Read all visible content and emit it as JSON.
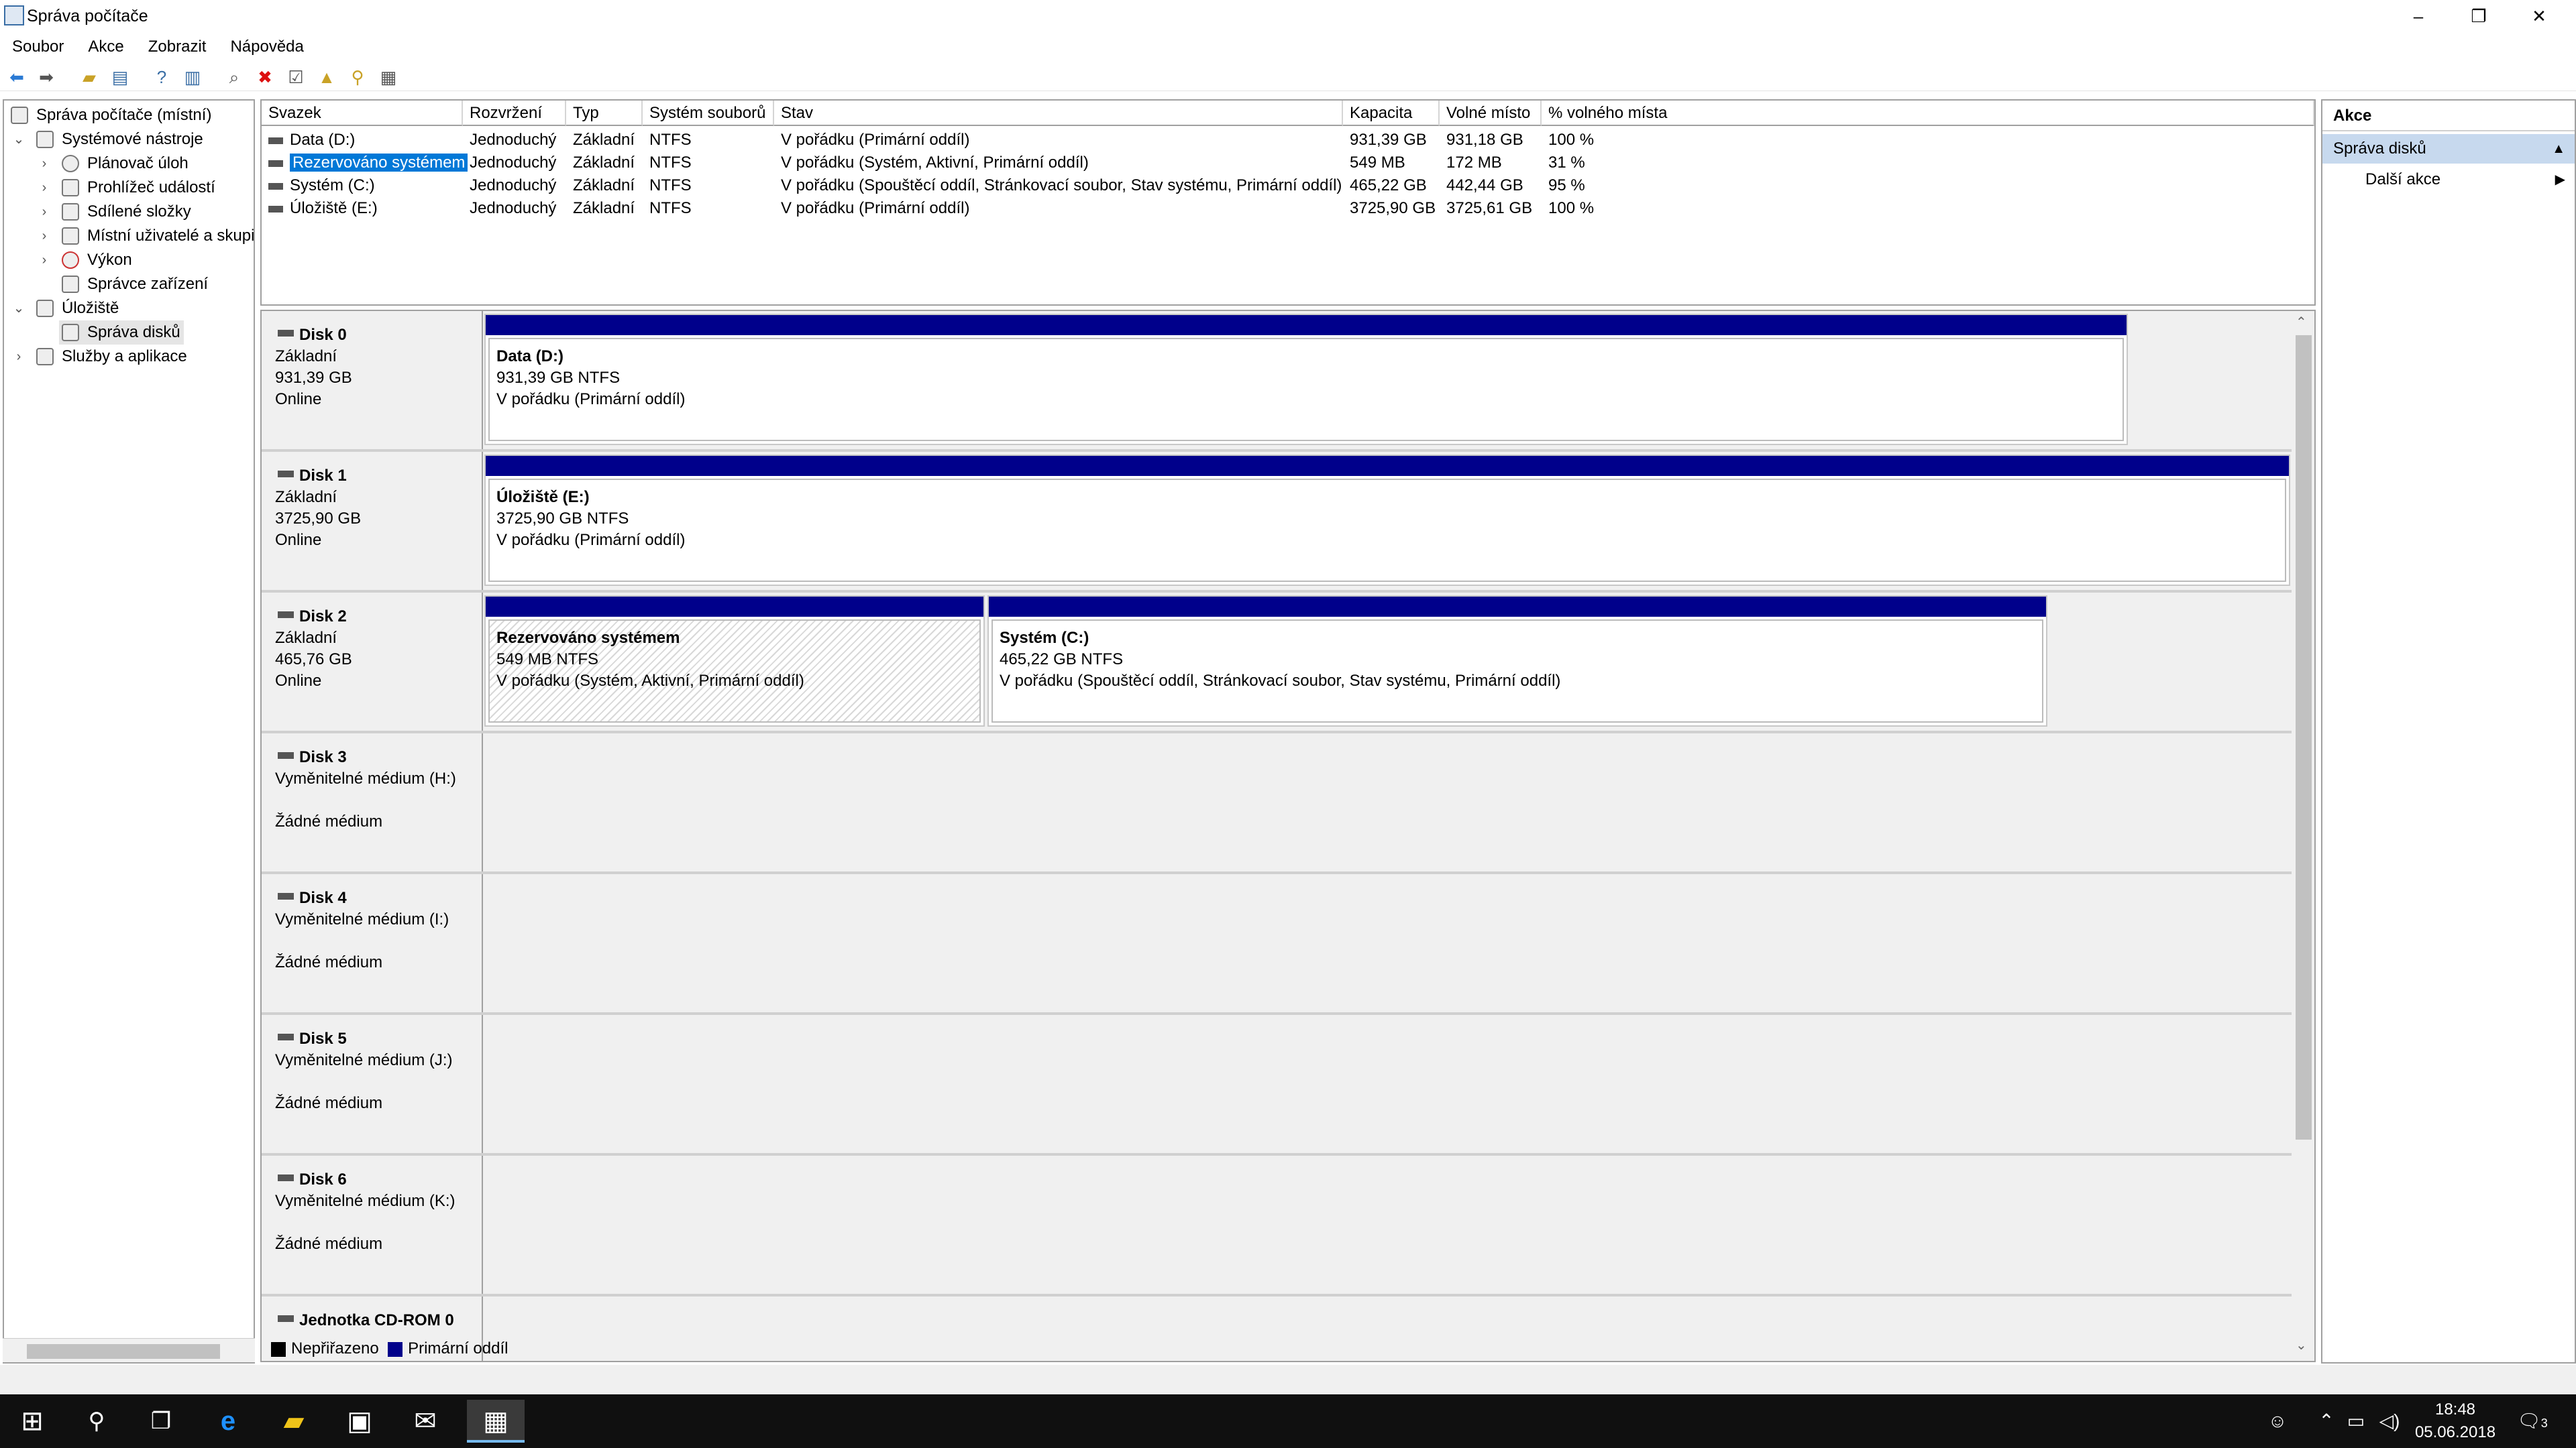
{
  "window": {
    "title": "Správa počítače",
    "min": "–",
    "restore": "❐",
    "close": "✕"
  },
  "menu": [
    "Soubor",
    "Akce",
    "Zobrazit",
    "Nápověda"
  ],
  "tree": [
    {
      "label": "Správa počítače (místní)",
      "level": 0,
      "exp": ""
    },
    {
      "label": "Systémové nástroje",
      "level": 1,
      "exp": "⌄"
    },
    {
      "label": "Plánovač úloh",
      "level": 2,
      "exp": "›"
    },
    {
      "label": "Prohlížeč událostí",
      "level": 2,
      "exp": "›"
    },
    {
      "label": "Sdílené složky",
      "level": 2,
      "exp": "›"
    },
    {
      "label": "Místní uživatelé a skupi",
      "level": 2,
      "exp": "›"
    },
    {
      "label": "Výkon",
      "level": 2,
      "exp": "›"
    },
    {
      "label": "Správce zařízení",
      "level": 2,
      "exp": ""
    },
    {
      "label": "Úložiště",
      "level": 1,
      "exp": "⌄"
    },
    {
      "label": "Správa disků",
      "level": 2,
      "exp": ""
    },
    {
      "label": "Služby a aplikace",
      "level": 1,
      "exp": "›"
    }
  ],
  "volumes": {
    "headers": [
      "Svazek",
      "Rozvržení",
      "Typ",
      "Systém souborů",
      "Stav",
      "Kapacita",
      "Volné místo",
      "% volného místa"
    ],
    "rows": [
      [
        "Data (D:)",
        "Jednoduchý",
        "Základní",
        "NTFS",
        "V pořádku (Primární oddíl)",
        "931,39 GB",
        "931,18 GB",
        "100 %"
      ],
      [
        "Rezervováno systémem",
        "Jednoduchý",
        "Základní",
        "NTFS",
        "V pořádku (Systém, Aktivní, Primární oddíl)",
        "549 MB",
        "172 MB",
        "31 %"
      ],
      [
        "Systém (C:)",
        "Jednoduchý",
        "Základní",
        "NTFS",
        "V pořádku (Spouštěcí oddíl, Stránkovací soubor, Stav systému, Primární oddíl)",
        "465,22 GB",
        "442,44 GB",
        "95 %"
      ],
      [
        "Úložiště (E:)",
        "Jednoduchý",
        "Základní",
        "NTFS",
        "V pořádku (Primární oddíl)",
        "3725,90 GB",
        "3725,61 GB",
        "100 %"
      ]
    ]
  },
  "disks": [
    {
      "name": "Disk 0",
      "l1": "Základní",
      "l2": "931,39 GB",
      "l3": "Online",
      "parts": [
        {
          "title": "Data  (D:)",
          "size": "931,39 GB NTFS",
          "status": "V pořádku (Primární oddíl)",
          "hatch": false
        }
      ]
    },
    {
      "name": "Disk 1",
      "l1": "Základní",
      "l2": "3725,90 GB",
      "l3": "Online",
      "parts": [
        {
          "title": "Úložiště  (E:)",
          "size": "3725,90 GB NTFS",
          "status": "V pořádku (Primární oddíl)",
          "hatch": false
        }
      ]
    },
    {
      "name": "Disk 2",
      "l1": "Základní",
      "l2": "465,76 GB",
      "l3": "Online",
      "parts": [
        {
          "title": "Rezervováno systémem",
          "size": "549 MB NTFS",
          "status": "V pořádku (Systém, Aktivní, Primární oddíl)",
          "hatch": true
        },
        {
          "title": "Systém  (C:)",
          "size": "465,22 GB NTFS",
          "status": "V pořádku (Spouštěcí oddíl, Stránkovací soubor, Stav systému, Primární oddíl)",
          "hatch": false
        }
      ]
    },
    {
      "name": "Disk 3",
      "l1": "Vyměnitelné médium (H:)",
      "l2": "",
      "l3": "Žádné médium",
      "parts": []
    },
    {
      "name": "Disk 4",
      "l1": "Vyměnitelné médium (I:)",
      "l2": "",
      "l3": "Žádné médium",
      "parts": []
    },
    {
      "name": "Disk 5",
      "l1": "Vyměnitelné médium (J:)",
      "l2": "",
      "l3": "Žádné médium",
      "parts": []
    },
    {
      "name": "Disk 6",
      "l1": "Vyměnitelné médium (K:)",
      "l2": "",
      "l3": "Žádné médium",
      "parts": []
    },
    {
      "name": "Jednotka CD-ROM 0",
      "l1": "",
      "l2": "",
      "l3": "",
      "parts": []
    }
  ],
  "legend": [
    {
      "label": "Nepřiřazeno",
      "color": "#000000"
    },
    {
      "label": "Primární oddíl",
      "color": "#00008b"
    }
  ],
  "actions": {
    "header": "Akce",
    "section": "Správa disků",
    "item": "Další akce"
  },
  "clock": {
    "time": "18:48",
    "date": "05.06.2018"
  },
  "notifications": "3",
  "colors": {
    "partition_bar": "#00008b",
    "selection": "#0078d7",
    "action_section": "#c7d9ee"
  }
}
